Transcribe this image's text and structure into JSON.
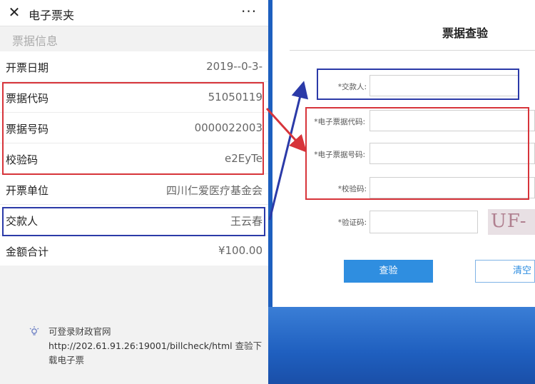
{
  "left_panel": {
    "app_title": "电子票夹",
    "close_glyph": "✕",
    "more_glyph": "···",
    "section_title": "票据信息",
    "rows": [
      {
        "label": "开票日期",
        "value": "2019--0-3-"
      },
      {
        "label": "票据代码",
        "value": "51050119"
      },
      {
        "label": "票据号码",
        "value": "0000022003"
      },
      {
        "label": "校验码",
        "value": "e2EyTe"
      },
      {
        "label": "开票单位",
        "value": "四川仁爱医疗基金会"
      },
      {
        "label": "交款人",
        "value": "王云春"
      },
      {
        "label": "金额合计",
        "value": "¥100.00"
      }
    ],
    "tip_prefix": "可登录财政官网",
    "tip_url": "http://202.61.91.26:19001/billcheck/html",
    "tip_suffix": "查验下载电子票"
  },
  "right_panel": {
    "title": "票据查验",
    "fields": {
      "payer_label": "*交款人:",
      "code_label": "*电子票据代码:",
      "number_label": "*电子票据号码:",
      "check_label": "*校验码:",
      "captcha_label": "*验证码:"
    },
    "captcha_text": "UF-VH",
    "check_button": "查验",
    "clear_button": "清空"
  },
  "colors": {
    "red_annotation": "#d7343a",
    "blue_annotation": "#2b3aa8",
    "button_blue": "#2f8ee0"
  },
  "icons": {
    "close": "close-icon",
    "more": "more-icon",
    "tip": "lightbulb-icon"
  }
}
